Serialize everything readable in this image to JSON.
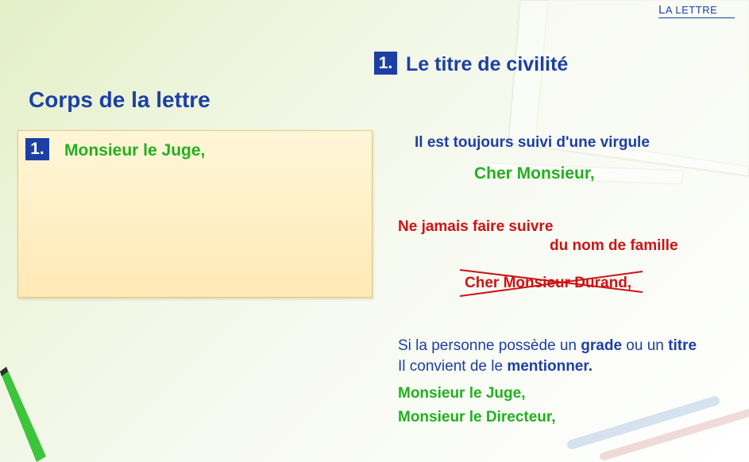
{
  "header": {
    "link_label_first": "L",
    "link_label_rest": "a lettre"
  },
  "page_title": "Corps de la lettre",
  "example_box": {
    "number": "1.",
    "text": "Monsieur le Juge,"
  },
  "section": {
    "number": "1.",
    "title": "Le titre de civilité"
  },
  "rule": "Il est toujours suivi d'une virgule",
  "good_example": "Cher Monsieur,",
  "warning": {
    "line1": "Ne jamais faire suivre",
    "line2": "du nom de famille"
  },
  "bad_example": "Cher Monsieur Durand,",
  "note": {
    "part1": "Si la personne possède un ",
    "bold1": "grade",
    "part2": " ou un ",
    "bold2": "titre",
    "line2_part1": "Il convient de le ",
    "line2_bold": "mentionner",
    "line2_end": "."
  },
  "title_examples": [
    "Monsieur le Juge,",
    "Monsieur le Directeur,"
  ],
  "colors": {
    "blue": "#1d3fa5",
    "green": "#22b01f",
    "red": "#cc1414",
    "box": "#ffe9b6"
  }
}
